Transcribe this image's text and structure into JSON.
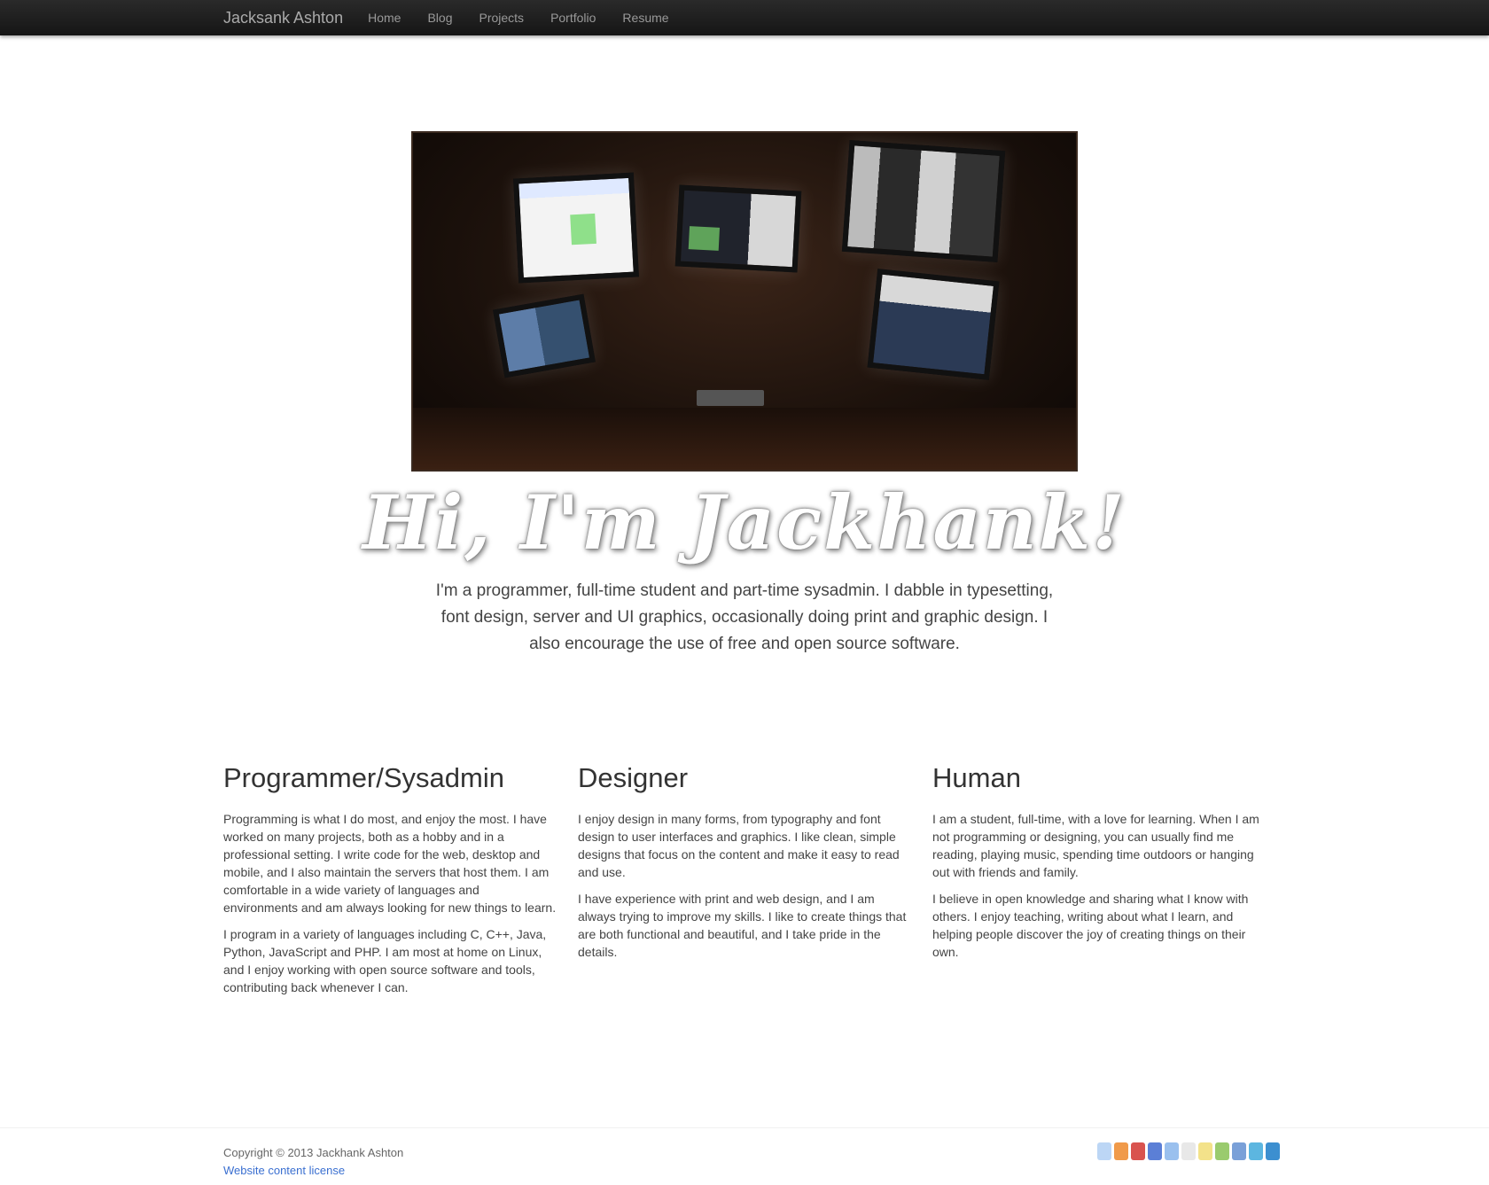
{
  "navbar": {
    "brand": "Jacksank Ashton",
    "links": [
      "Home",
      "Blog",
      "Projects",
      "Portfolio",
      "Resume"
    ]
  },
  "hero": {
    "headline": "Hi, I'm Jackhank!",
    "intro": "I'm a programmer, full-time student and part-time sysadmin. I dabble in typesetting, font design, server and UI graphics, occasionally doing print and graphic design. I also encourage the use of free and open source software."
  },
  "columns": [
    {
      "title": "Programmer/Sysadmin",
      "paragraphs": [
        "Programming is what I do most, and enjoy the most. I have worked on many projects, both as a hobby and in a professional setting. I write code for the web, desktop and mobile, and I also maintain the servers that host them. I am comfortable in a wide variety of languages and environments and am always looking for new things to learn.",
        "I program in a variety of languages including C, C++, Java, Python, JavaScript and PHP. I am most at home on Linux, and I enjoy working with open source software and tools, contributing back whenever I can."
      ]
    },
    {
      "title": "Designer",
      "paragraphs": [
        "I enjoy design in many forms, from typography and font design to user interfaces and graphics. I like clean, simple designs that focus on the content and make it easy to read and use.",
        "I have experience with print and web design, and I am always trying to improve my skills. I like to create things that are both functional and beautiful, and I take pride in the details."
      ]
    },
    {
      "title": "Human",
      "paragraphs": [
        "I am a student, full-time, with a love for learning. When I am not programming or designing, you can usually find me reading, playing music, spending time outdoors or hanging out with friends and family.",
        "I believe in open knowledge and sharing what I know with others. I enjoy teaching, writing about what I learn, and helping people discover the joy of creating things on their own."
      ]
    }
  ],
  "footer": {
    "copyright": "Copyright © 2013 Jackhank Ashton",
    "license": "Website content license"
  },
  "badge_colors": [
    "#bcd6f5",
    "#f09a4a",
    "#d9534f",
    "#5b7fd6",
    "#9ac0ee",
    "#e8e8e8",
    "#f3e28a",
    "#9acb6e",
    "#7aa0d8",
    "#5cb6e0",
    "#3c8fd0"
  ]
}
